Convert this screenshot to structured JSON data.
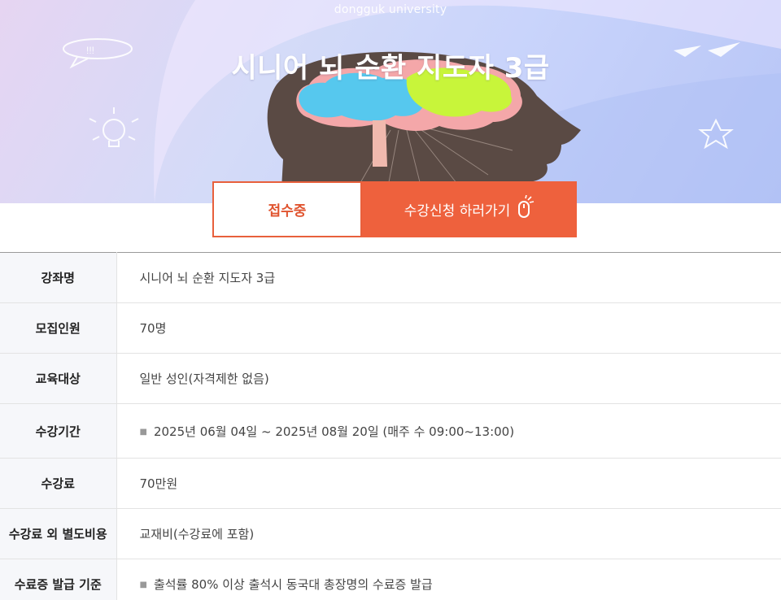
{
  "hero": {
    "university": "dongguk university",
    "title": "시니어 뇌 순환 지도자 3급"
  },
  "actions": {
    "status_label": "접수중",
    "apply_label": "수강신청 하러가기"
  },
  "icons": {
    "apply": "mouse-click-icon",
    "bullet": "bullet-dot-icon"
  },
  "colors": {
    "accent": "#ee613d",
    "brain_blue": "#56c8ee",
    "brain_green": "#c8f53a",
    "brain_pink": "#f4a7a9",
    "head": "#5a4a44"
  },
  "details": [
    {
      "label": "강좌명",
      "value": "시니어 뇌 순환 지도자 3급",
      "bullet": false
    },
    {
      "label": "모집인원",
      "value": "70명",
      "bullet": false
    },
    {
      "label": "교육대상",
      "value": "일반 성인(자격제한 없음)",
      "bullet": false
    },
    {
      "label": "수강기간",
      "value": "2025년 06월 04일 ~ 2025년 08월 20일 (매주 수 09:00~13:00)",
      "bullet": true
    },
    {
      "label": "수강료",
      "value": "70만원",
      "bullet": false
    },
    {
      "label": "수강료 외 별도비용",
      "value": "교재비(수강료에 포함)",
      "bullet": false
    },
    {
      "label": "수료증 발급 기준",
      "value": "출석률 80% 이상 출석시 동국대 총장명의 수료증 발급",
      "bullet": true
    }
  ]
}
